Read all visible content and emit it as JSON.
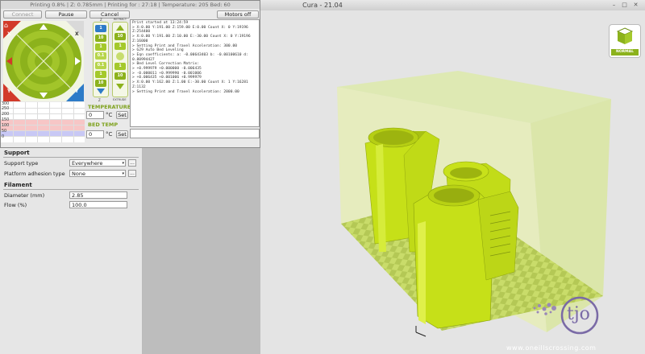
{
  "app": {
    "title": "Cura - 21.04",
    "window_controls": [
      "–",
      "□",
      "✕"
    ]
  },
  "printer_window": {
    "title": "Printing 0.8% | Z: 0.785mm | Printing for : 27:18 | Temperature: 205 Bed: 60",
    "buttons": {
      "connect": "Connect",
      "pause": "Pause",
      "cancel": "Cancel",
      "motors_off": "Motors off"
    },
    "log_lines": [
      "Print started at 13:24:59",
      "> X:0.00 Y:191.00 Z:159.00 E:0.00 Count X: 0 Y:19196",
      "Z:254400",
      "> X:0.00 Y:191.00 Z:10.00 E:-30.00 Count X: 0 Y:19196",
      "Z:16000",
      "> Setting Print and Travel Acceleration: 300.00",
      "> G29 Auto Bed Leveling",
      "> Eqn coefficients: a: -0.00643403 b: -0.00100610 d:",
      "0.80994427",
      "> Bed Level Correction Matrix:",
      "> +0.999979 +0.000000 -0.006435",
      "> -0.000011 +0.999990 -0.001006",
      "> +0.006435 +0.001006 +0.999979",
      "> X:0.00 Y:162.00 Z:1.00 E:-30.00 Count X: 1 Y:16281",
      "Z:1132",
      "> Setting Print and Travel Acceleration: 2000.00"
    ],
    "jog": {
      "xy_labels": {
        "home": "⌂",
        "x_minus": "X",
        "x_plus": "X",
        "y_plus": "Y",
        "y_minus": "Y"
      },
      "z_steps": [
        "10",
        "1",
        "0.1",
        "0.1",
        "1",
        "10"
      ],
      "z_captions": {
        "top": "Z",
        "bottom": "Z"
      },
      "e_steps": [
        "10",
        "1",
        "1",
        "10"
      ],
      "e_captions": {
        "top": "RETRACT",
        "bottom": "EXTRUDE"
      },
      "z_home": "1",
      "e_home": "2"
    },
    "temperature_label": "TEMPERATURE",
    "temperature_value": "0",
    "bed_temp_label": "BED TEMP",
    "bed_temp_value": "0",
    "unit": "°C",
    "set_label": "Set",
    "graph_ticks": [
      "300",
      "250",
      "200",
      "150",
      "100",
      "50",
      "0"
    ]
  },
  "sidebar": {
    "support_header": "Support",
    "support_type_label": "Support type",
    "support_type_value": "Everywhere",
    "adhesion_label": "Platform adhesion type",
    "adhesion_value": "None",
    "filament_header": "Filament",
    "diameter_label": "Diameter (mm)",
    "diameter_value": "2.85",
    "flow_label": "Flow (%)",
    "flow_value": "100.0",
    "more_label": "..."
  },
  "view": {
    "mode_label": "NORMAL",
    "watermark": "www.oneillscrossing.com",
    "logo_text": "tjo"
  },
  "colors": {
    "model": "#c8e11a",
    "accent": "#7fa21f",
    "jog_green": "#8cb21c",
    "jog_blue": "#2d7bc8",
    "jog_red": "#d23a2a"
  }
}
